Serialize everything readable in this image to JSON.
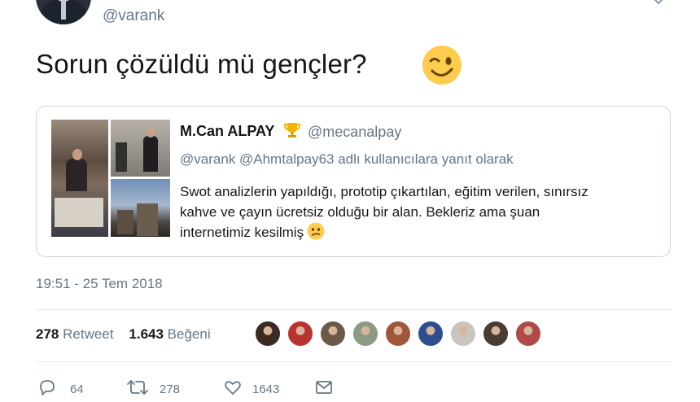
{
  "author": {
    "handle": "@varank"
  },
  "tweet": {
    "text": "Sorun çözüldü mü gençler?",
    "emoji": "winking-face"
  },
  "quote": {
    "name": "M.Can ALPAY",
    "name_emoji": "trophy",
    "handle": "@mecanalpay",
    "reply_to": "@varank @Ahmtalpay63 adlı kullanıcılara yanıt olarak",
    "body_lines": [
      "Swot analizlerin yapıldığı, prototip çıkartılan, eğitim verilen, sınırsız",
      "kahve ve çayın ücretsiz olduğu bir alan. Bekleriz ama şuan",
      "internetimiz kesilmiş"
    ],
    "body_emoji": "confused-face"
  },
  "timestamp": "19:51 - 25 Tem 2018",
  "stats": {
    "retweet_count": "278",
    "retweet_label": "Retweet",
    "like_count": "1.643",
    "like_label": "Beğeni"
  },
  "likers": [
    {
      "color": "#3a2a22"
    },
    {
      "color": "#b8322f"
    },
    {
      "color": "#6b5a48"
    },
    {
      "color": "#8c9a86"
    },
    {
      "color": "#a0563a"
    },
    {
      "color": "#2d4f8f"
    },
    {
      "color": "#c9c4bd"
    },
    {
      "color": "#4a3b33"
    },
    {
      "color": "#b04a4a"
    }
  ],
  "actions": {
    "reply_count": "64",
    "retweet_count": "278",
    "like_count": "1643"
  },
  "colors": {
    "text": "#14171a",
    "secondary": "#657786",
    "border": "#ccd6dd",
    "divider": "#e6ecf0",
    "emoji_yellow": "#ffcc4d"
  }
}
